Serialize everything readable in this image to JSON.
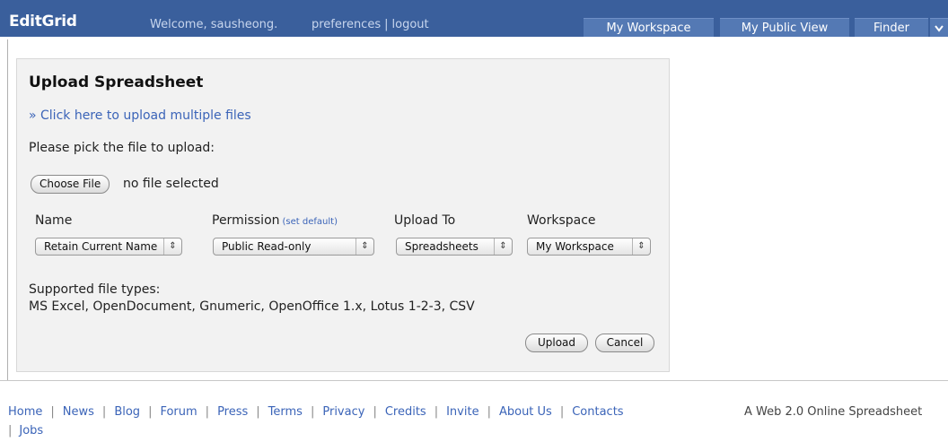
{
  "header": {
    "logo": "EditGrid",
    "welcome": "Welcome, sausheong.",
    "preferences": "preferences",
    "separator": "|",
    "logout": "logout",
    "tabs": [
      {
        "label": "My Workspace"
      },
      {
        "label": "My Public View"
      },
      {
        "label": "Finder"
      }
    ],
    "more_icon": "chevron-down-icon"
  },
  "panel": {
    "title": "Upload Spreadsheet",
    "multi_link": "» Click here to upload multiple files",
    "pick_label": "Please pick the file to upload:",
    "choose_button": "Choose File",
    "file_status": "no file selected",
    "columns": {
      "name": "Name",
      "permission": "Permission",
      "set_default": "(set default)",
      "upload_to": "Upload To",
      "workspace": "Workspace"
    },
    "selects": {
      "name": "Retain Current Name",
      "permission": "Public Read-only",
      "upload_to": "Spreadsheets",
      "workspace": "My Workspace"
    },
    "select_arrow": "⇕",
    "supported_label": "Supported file types:",
    "supported_types": "MS Excel, OpenDocument, Gnumeric, OpenOffice 1.x, Lotus 1-2-3, CSV",
    "upload_button": "Upload",
    "cancel_button": "Cancel"
  },
  "footer": {
    "links": [
      "Home",
      "News",
      "Blog",
      "Forum",
      "Press",
      "Terms",
      "Privacy",
      "Credits",
      "Invite",
      "About Us",
      "Contacts"
    ],
    "separator": "|",
    "line2_link": "Jobs",
    "tagline": "A Web 2.0 Online Spreadsheet"
  },
  "colors": {
    "header_bg": "#3a5f9c",
    "tab_bg": "#5479b4",
    "link": "#3b64b8",
    "panel_bg": "#f2f2f2"
  }
}
